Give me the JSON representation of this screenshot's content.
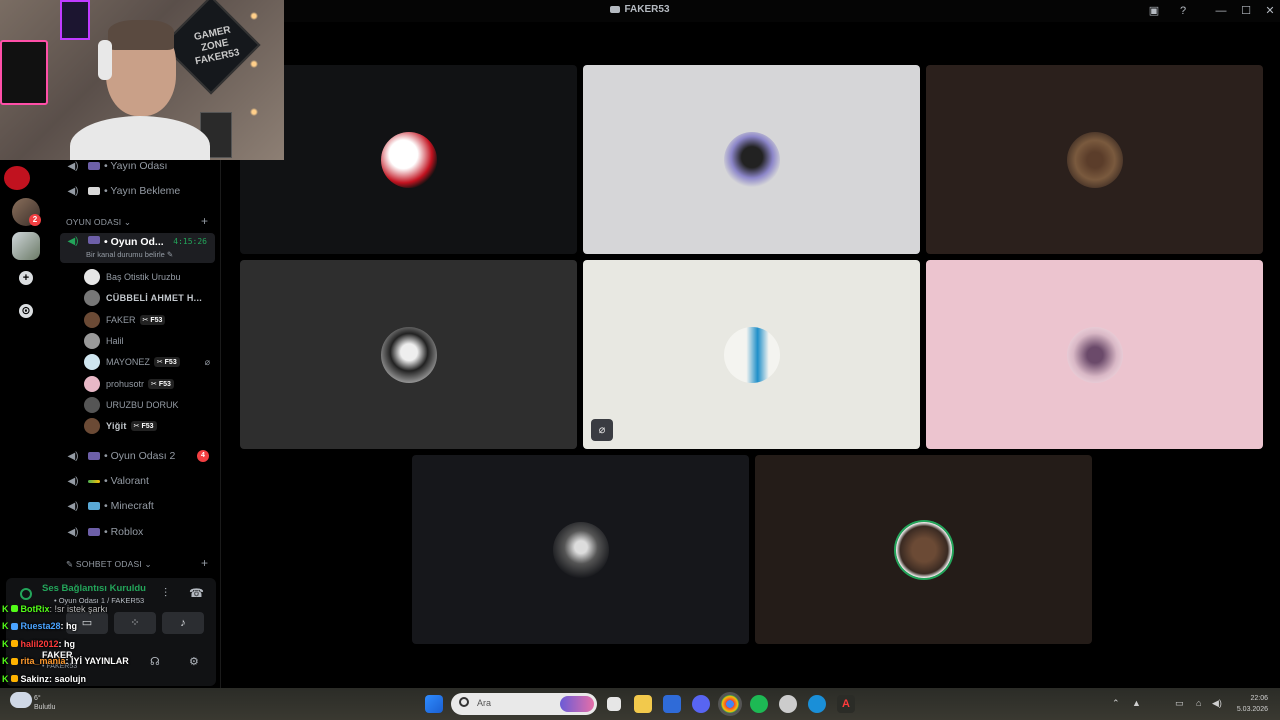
{
  "window": {
    "title": "FAKER53"
  },
  "webcam": {
    "sign_text": "GAMER ZONE FAKER53"
  },
  "rail": {
    "dm_badge": "2",
    "add_label": "+",
    "discover_label": "⊙"
  },
  "channels": {
    "top": [
      {
        "label": "• Yayın Odası"
      },
      {
        "label": "• Yayın Bekleme"
      }
    ],
    "category_game": "OYUN ODASI ⌄",
    "active": {
      "label": "• Oyun Od...",
      "timer": "4:15:26",
      "sub": "Bir kanal durumu belirle ✎"
    },
    "members": [
      {
        "name": "Baş Otistik Uruzbu",
        "tag": "",
        "bold": false
      },
      {
        "name": "CÜBBELİ AHMET H...",
        "tag": "",
        "bold": true
      },
      {
        "name": "FAKER",
        "tag": "✂ F53",
        "bold": false
      },
      {
        "name": "Halil",
        "tag": "",
        "bold": false
      },
      {
        "name": "MAYONEZ",
        "tag": "✂ F53",
        "bold": false
      },
      {
        "name": "prohusotr",
        "tag": "✂ F53",
        "bold": false
      },
      {
        "name": "URUZBU DORUK",
        "tag": "",
        "bold": false
      },
      {
        "name": "Yiğit",
        "tag": "✂ F53",
        "bold": true
      }
    ],
    "others": [
      {
        "label": "• Oyun Odası 2",
        "count": "4"
      },
      {
        "label": "• Valorant",
        "count": ""
      },
      {
        "label": "• Minecraft",
        "count": ""
      },
      {
        "label": "• Roblox",
        "count": ""
      }
    ],
    "category_chat": "✎ SOHBET ODASI ⌄"
  },
  "voice": {
    "status": "Ses Bağlantısı Kuruldu",
    "channel": "• Oyun Odası 1 / FAKER53",
    "user_name": "FAKER",
    "user_sub": "• FAKER53"
  },
  "chat": [
    {
      "user": "BotRix",
      "msg": ": !sr istek şarkı",
      "color": "#53fc18"
    },
    {
      "user": "Ruesta28",
      "msg": ": hg",
      "color": "#4aa3ff"
    },
    {
      "user": "halil2012",
      "msg": ": hg",
      "color": "#ff3b3b"
    },
    {
      "user": "rita_mania",
      "msg": ": İYİ YAYINLAR",
      "color": "#ff9a2e"
    },
    {
      "user": "Sakinz",
      "msg": ": saolujn",
      "color": "#ffffff"
    }
  ],
  "taskbar": {
    "search_placeholder": "Ara",
    "weather_temp": "6°",
    "weather_desc": "Bulutlu",
    "time": "22:06",
    "date": "5.03.2026"
  },
  "colors": {
    "accent_green": "#23a55a",
    "danger_red": "#f23f42",
    "tile_colors": [
      "#111214",
      "#d6d6d8",
      "#2b201c",
      "#2e2e2e",
      "#e8e8e2",
      "#ecc4cf",
      "#16171b",
      "#241c18"
    ]
  }
}
